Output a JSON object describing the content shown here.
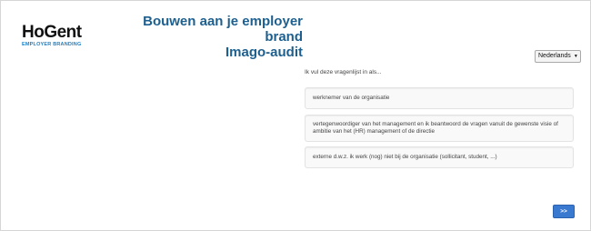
{
  "logo": {
    "word": "HoGent",
    "tagline": "EMPLOYER BRANDING"
  },
  "header": {
    "title_line1": "Bouwen aan je employer brand",
    "title_line2": "Imago-audit"
  },
  "language_select": {
    "selected": "Nederlands"
  },
  "survey": {
    "prompt": "Ik vul deze vragenlijst in als...",
    "options": [
      {
        "label": "werknemer van de organisatie"
      },
      {
        "label": "vertegenwoordiger van het management en ik beantwoord de vragen vanuit de gewenste visie of ambitie van het (HR) management of de directie"
      },
      {
        "label": "externe d.w.z. ik werk (nog) niet bij de organisatie (sollicitant, student, ...)"
      }
    ]
  },
  "navigation": {
    "next_label": ">>"
  },
  "colors": {
    "title": "#1d5f8e",
    "logo_accent": "#1a7fc4",
    "button": "#3a79d0"
  }
}
